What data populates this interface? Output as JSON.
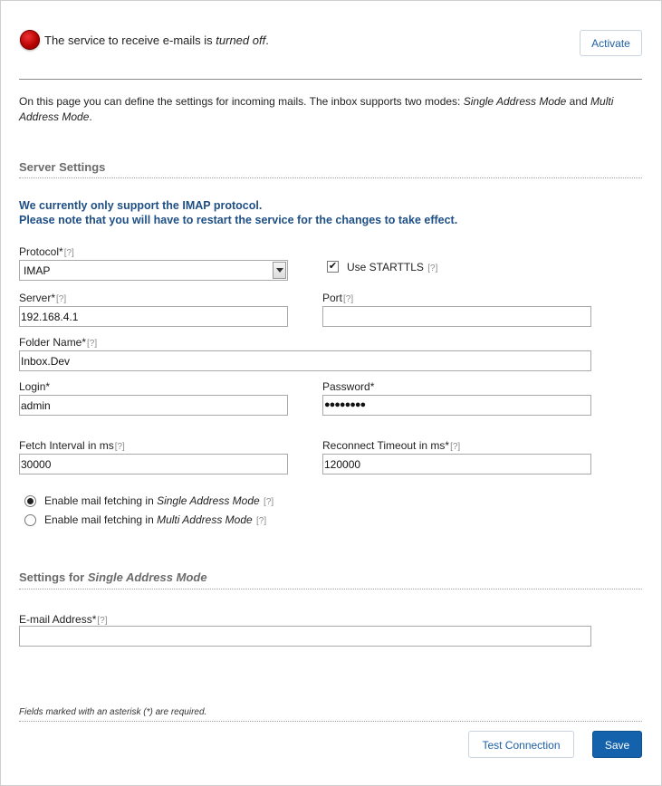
{
  "status": {
    "prefix": "The service to receive e-mails is ",
    "state": "turned off",
    "suffix": ".",
    "indicator_color": "#c00000",
    "activate_label": "Activate"
  },
  "intro": {
    "text": "On this page you can define the settings for incoming mails. The inbox supports two modes: ",
    "mode_single": "Single Address Mode",
    "and": " and ",
    "mode_multi": "Multi Address Mode",
    "end": "."
  },
  "server_section": {
    "title": "Server Settings",
    "notice_line1": "We currently only support the IMAP protocol.",
    "notice_line2": "Please note that you will have to restart the service for the changes to take effect."
  },
  "help_marker": "[?]",
  "fields": {
    "protocol": {
      "label": "Protocol*",
      "value": "IMAP"
    },
    "starttls": {
      "label": "Use STARTTLS",
      "checked": true
    },
    "server": {
      "label": "Server*",
      "value": "192.168.4.1"
    },
    "port": {
      "label": "Port",
      "value": ""
    },
    "folder": {
      "label": "Folder Name*",
      "value": "Inbox.Dev"
    },
    "login": {
      "label": "Login*",
      "value": "admin"
    },
    "password": {
      "label": "Password*",
      "value": "●●●●●●●●"
    },
    "fetch_interval": {
      "label": "Fetch Interval in ms",
      "value": "30000"
    },
    "reconnect_timeout": {
      "label": "Reconnect Timeout in ms*",
      "value": "120000"
    }
  },
  "mode_options": {
    "prefix": "Enable mail fetching in ",
    "single": "Single Address Mode",
    "multi": "Multi Address Mode",
    "selected": "single"
  },
  "single_section": {
    "title_prefix": "Settings for ",
    "title_mode": "Single Address Mode",
    "email_label": "E-mail Address*",
    "email_value": ""
  },
  "footer": {
    "note": "Fields marked with an asterisk (*) are required.",
    "test_label": "Test Connection",
    "save_label": "Save"
  }
}
